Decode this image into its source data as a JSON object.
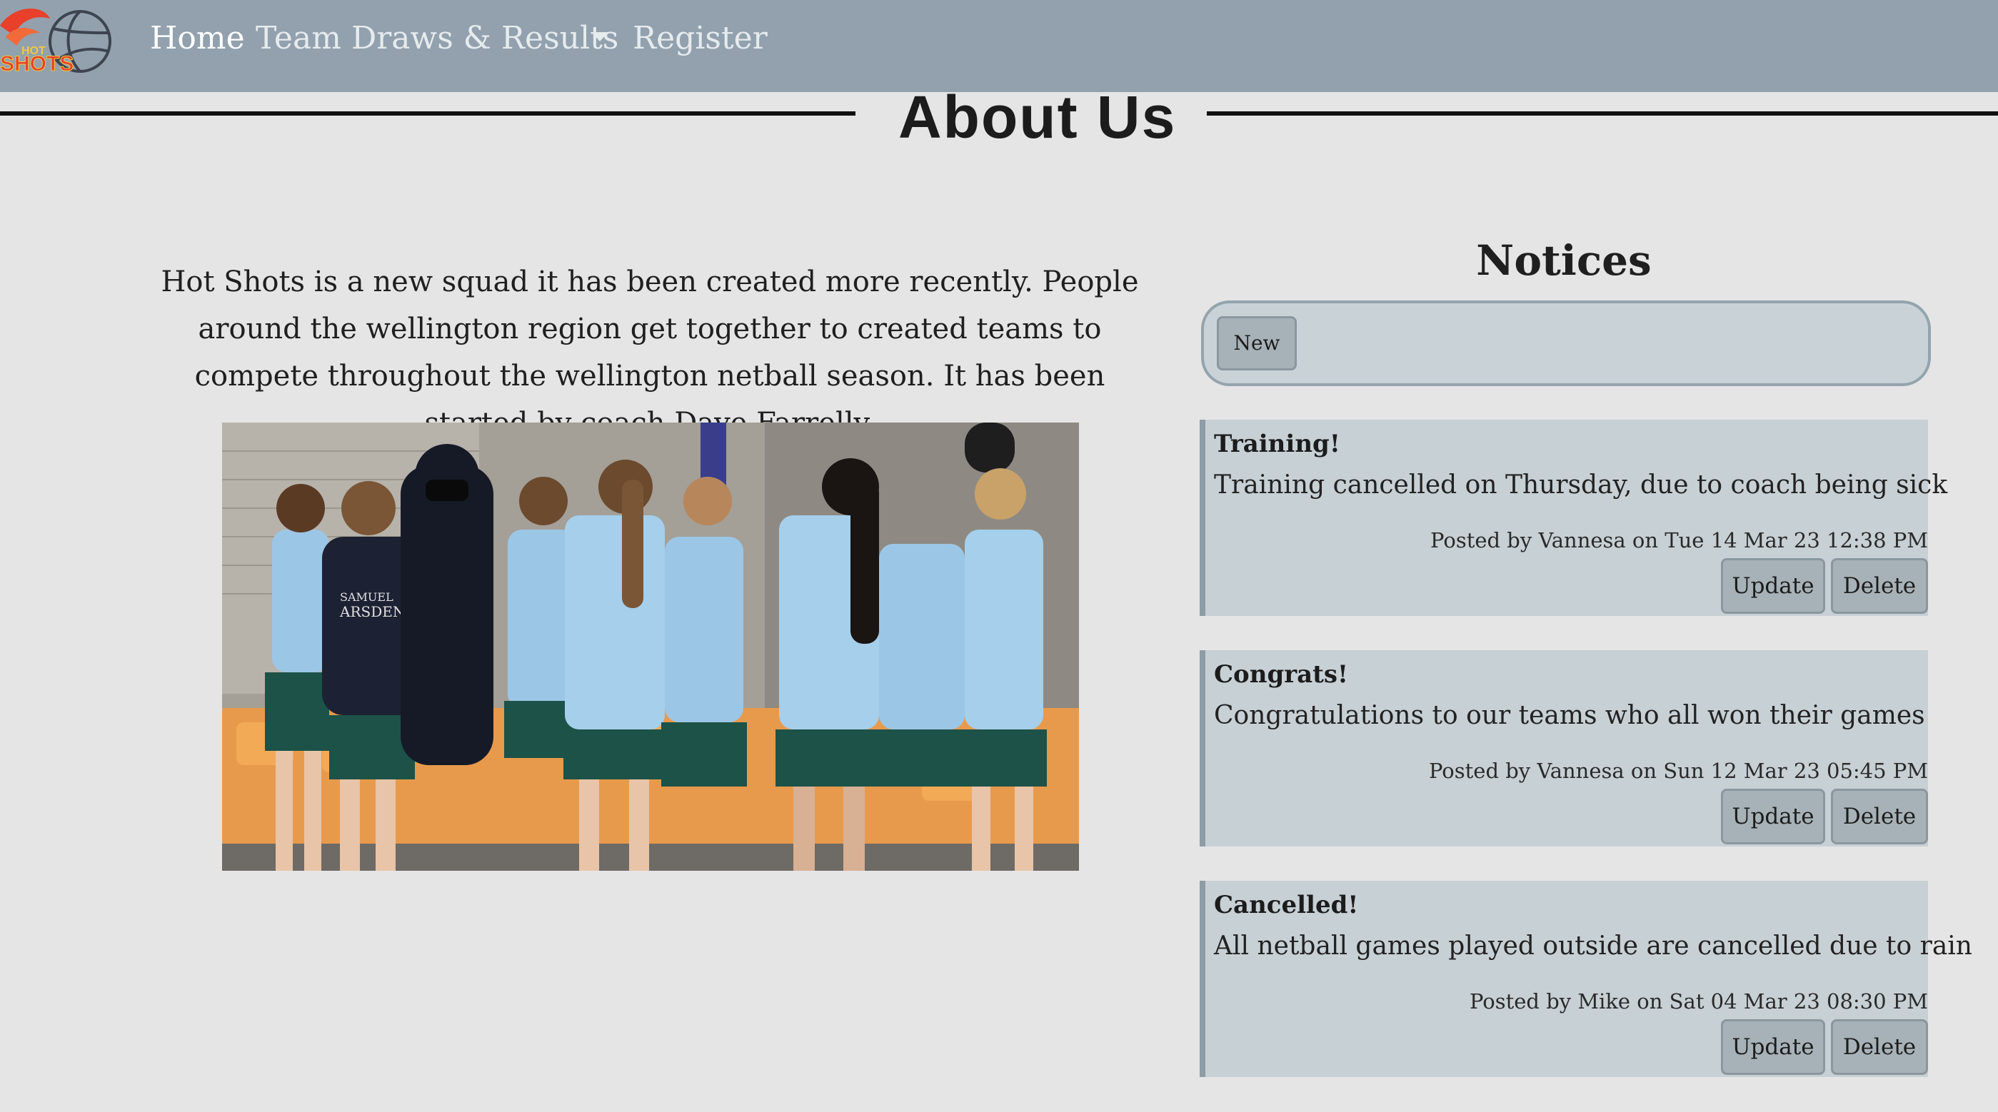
{
  "brand": {
    "logo_text_top": "HOT",
    "logo_text_bottom": "SHOTS"
  },
  "nav": {
    "items": [
      {
        "label": "Home"
      },
      {
        "label": "Team"
      },
      {
        "label": "Draws & Results"
      },
      {
        "label": "Register"
      }
    ]
  },
  "about": {
    "title": "About Us",
    "text": "Hot Shots is a new squad it has been created more recently. People around the wellington region get together to created teams to compete throughout the wellington netball season. It has been started by coach Dave Farrelly."
  },
  "photo": {
    "jersey_text_1": "SAMUEL",
    "jersey_text_2": "ARSDEN"
  },
  "notices": {
    "title": "Notices",
    "new_label": "New",
    "update_label": "Update",
    "delete_label": "Delete",
    "items": [
      {
        "title": "Training!",
        "body": "Training cancelled on Thursday, due to coach being sick",
        "meta": "Posted by Vannesa on Tue 14 Mar 23 12:38 PM"
      },
      {
        "title": "Congrats!",
        "body": "Congratulations to our teams who all won their games",
        "meta": "Posted by Vannesa on Sun 12 Mar 23 05:45 PM"
      },
      {
        "title": "Cancelled!",
        "body": "All netball games played outside are cancelled due to rain",
        "meta": "Posted by Mike on Sat 04 Mar 23 08:30 PM"
      }
    ]
  },
  "colors": {
    "navbar": "#92a1ad",
    "page_bg": "#e5e5e5",
    "notice_bg": "#c7d0d5",
    "button_bg": "#a7b2b8",
    "logo_red": "#e8402a"
  }
}
